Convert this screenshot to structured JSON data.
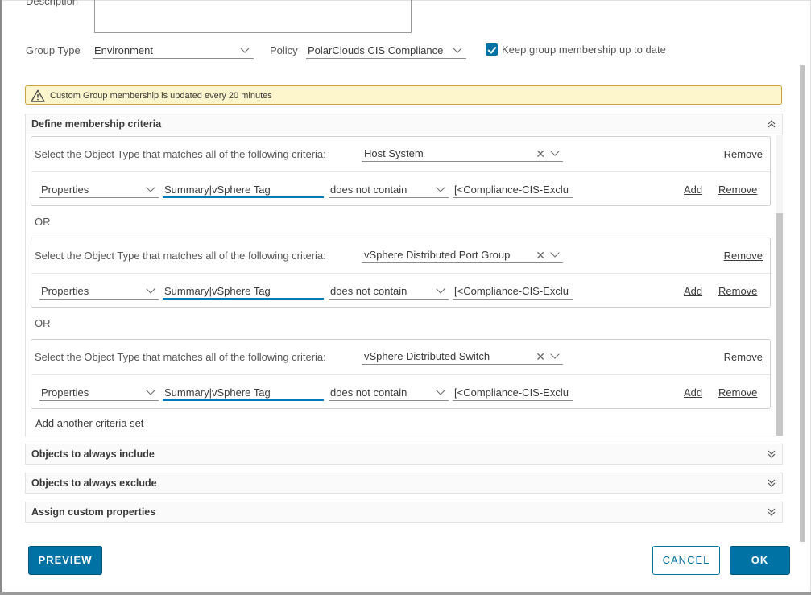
{
  "form": {
    "description_label": "Description",
    "group_type_label": "Group Type",
    "group_type_value": "Environment",
    "policy_label": "Policy",
    "policy_value": "PolarClouds CIS Compliance",
    "keep_updated_label": "Keep group membership up to date",
    "keep_updated_checked": true
  },
  "alert": {
    "text": "Custom Group membership is updated every 20 minutes"
  },
  "membership": {
    "title": "Define membership criteria",
    "criteria_prompt": "Select the Object Type that matches all of the following criteria:",
    "or_label": "OR",
    "add_link": "Add",
    "remove_link": "Remove",
    "add_criteria_set": "Add another criteria set",
    "sets": [
      {
        "object_type": "Host System",
        "property_type": "Properties",
        "property": "Summary|vSphere Tag",
        "operator": "does not contain",
        "value": "[<Compliance-CIS-Exclu"
      },
      {
        "object_type": "vSphere Distributed Port Group",
        "property_type": "Properties",
        "property": "Summary|vSphere Tag",
        "operator": "does not contain",
        "value": "[<Compliance-CIS-Exclu"
      },
      {
        "object_type": "vSphere Distributed Switch",
        "property_type": "Properties",
        "property": "Summary|vSphere Tag",
        "operator": "does not contain",
        "value": "[<Compliance-CIS-Exclu"
      }
    ]
  },
  "sections": {
    "include": "Objects to always include",
    "exclude": "Objects to always exclude",
    "custom_props": "Assign custom properties"
  },
  "buttons": {
    "preview": "PREVIEW",
    "cancel": "CANCEL",
    "ok": "OK"
  },
  "colors": {
    "accent": "#0072a3",
    "alert_bg": "#fdf5cc",
    "alert_border": "#c9a43a",
    "input_focus": "#0079b8"
  },
  "icons": {
    "alert": "warning-triangle-icon",
    "collapse": "double-chevron-up-icon",
    "expand": "double-chevron-down-icon",
    "dropdown": "chevron-down-icon",
    "clear": "close-icon",
    "checkbox": "checkmark-icon"
  }
}
